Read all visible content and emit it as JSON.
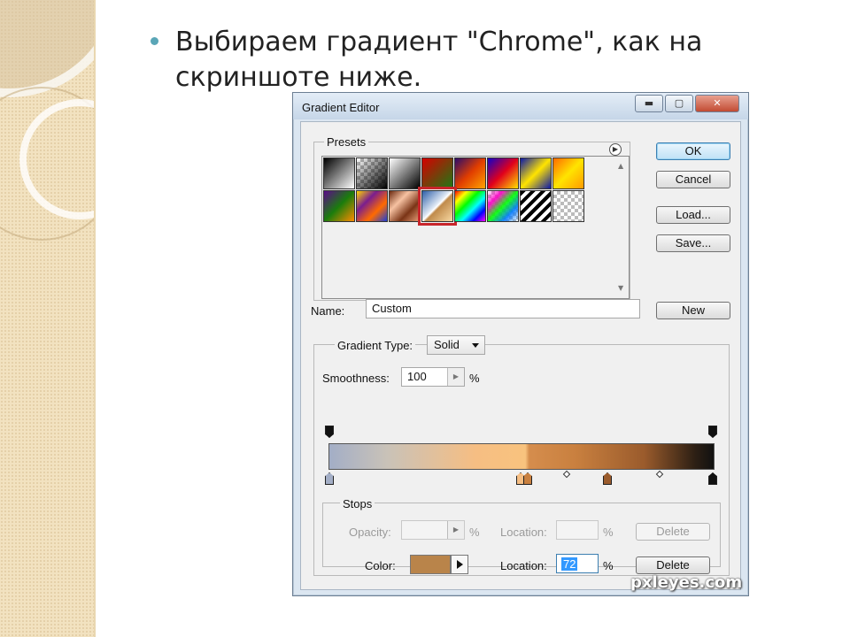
{
  "slide": {
    "text": "Выбираем градиент \"Chrome\", как на скриншоте ниже.",
    "bullet_color": "#5aa6b7"
  },
  "window": {
    "title": "Gradient Editor",
    "minimize_icon": "minimize-icon",
    "maximize_icon": "maximize-icon",
    "close_icon": "close-icon"
  },
  "presets": {
    "label": "Presets",
    "menu_icon": "circle-arrow-icon",
    "swatches_row1": [
      "black-white",
      "transparent-black",
      "white-black",
      "red-green",
      "violet-orange",
      "blue-red-yellow",
      "blue-yellow-blue",
      "orange-yellow"
    ],
    "swatches_row2": [
      "violet-green-orange",
      "yellow-violet-orange-blue",
      "copper",
      "chrome",
      "spectrum",
      "transparent-rainbow",
      "transparent-stripes",
      "transparent-checker"
    ],
    "selected": "chrome"
  },
  "buttons": {
    "ok": "OK",
    "cancel": "Cancel",
    "load": "Load...",
    "save": "Save...",
    "new": "New"
  },
  "name": {
    "label": "Name:",
    "value": "Custom"
  },
  "gradient_type": {
    "label": "Gradient Type:",
    "value": "Solid"
  },
  "smoothness": {
    "label": "Smoothness:",
    "value": "100",
    "unit": "%"
  },
  "stops": {
    "label": "Stops",
    "opacity_label": "Opacity:",
    "opacity_unit": "%",
    "opacity_location_label": "Location:",
    "opacity_location_unit": "%",
    "opacity_delete": "Delete",
    "color_label": "Color:",
    "color_value": "#b9844a",
    "color_location_label": "Location:",
    "color_location_value": "72",
    "color_location_unit": "%",
    "color_delete": "Delete"
  },
  "watermark": "pxleyes.com"
}
